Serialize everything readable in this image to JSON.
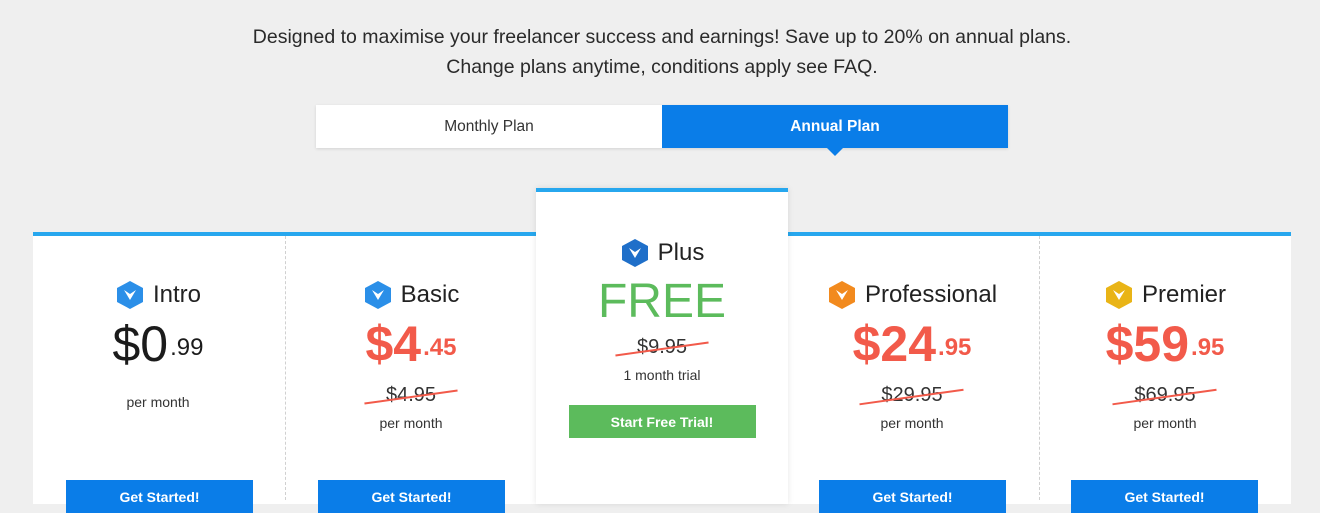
{
  "intro_text": "Designed to maximise your freelancer success and earnings! Save up to 20% on annual plans. Change plans anytime, conditions apply see FAQ.",
  "plan_toggle": {
    "monthly_label": "Monthly Plan",
    "annual_label": "Annual Plan",
    "selected": "Annual Plan"
  },
  "colors": {
    "accent_blue": "#0a7de8",
    "sale_red": "#f25a4a",
    "free_green": "#5cbb5c",
    "panel_border": "#27a7ee"
  },
  "plans": [
    {
      "name": "Intro",
      "icon": "intro-badge-icon",
      "price_main": "$0",
      "price_cents": ".99",
      "period": "per month",
      "button": "Get Started!"
    },
    {
      "name": "Basic",
      "icon": "basic-badge-icon",
      "price_main": "$4",
      "price_cents": ".45",
      "old_price": "$4.95",
      "period": "per month",
      "button": "Get Started!"
    },
    {
      "name": "Plus",
      "icon": "plus-badge-icon",
      "price_main": "FREE",
      "old_price": "$9.95",
      "period": "1 month trial",
      "button": "Start Free Trial!"
    },
    {
      "name": "Professional",
      "icon": "professional-badge-icon",
      "price_main": "$24",
      "price_cents": ".95",
      "old_price": "$29.95",
      "period": "per month",
      "button": "Get Started!"
    },
    {
      "name": "Premier",
      "icon": "premier-badge-icon",
      "price_main": "$59",
      "price_cents": ".95",
      "old_price": "$69.95",
      "period": "per month",
      "button": "Get Started!"
    }
  ]
}
